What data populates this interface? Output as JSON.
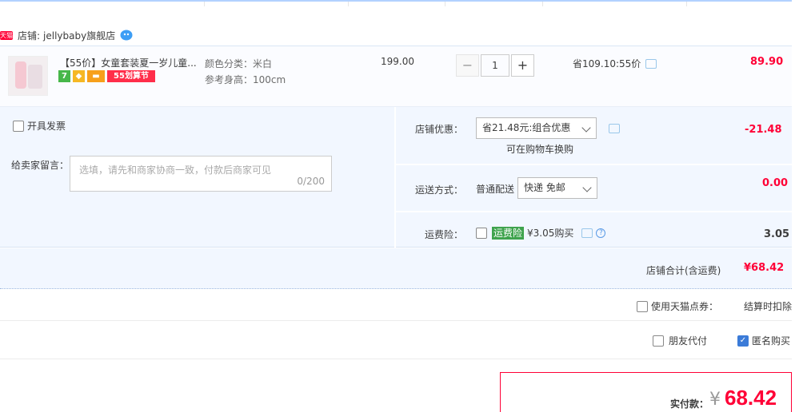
{
  "shop": {
    "badge": "天猫",
    "label": "店铺:",
    "name": "jellybaby旗舰店"
  },
  "item": {
    "title": "【55价】女童套装夏一岁儿童...",
    "badges": {
      "seven": "7",
      "promo": "55划算节"
    },
    "sku_color": "颜色分类：米白",
    "sku_height": "参考身高：100cm",
    "original_price": "199.00",
    "quantity": "1",
    "qty_minus": "−",
    "qty_plus": "+",
    "saved": "省109.10:55价",
    "price": "89.90"
  },
  "invoice": {
    "label": "开具发票"
  },
  "memo": {
    "label": "给卖家留言：",
    "placeholder": "选填，请先和商家协商一致，付款后商家可见",
    "count": "0/200"
  },
  "shop_discount": {
    "label": "店铺优惠：",
    "selected": "省21.48元:组合优惠",
    "note": "可在购物车换购",
    "value": "-21.48"
  },
  "shipping": {
    "label": "运送方式：",
    "type": "普通配送",
    "selected": "快递 免邮",
    "value": "0.00"
  },
  "insurance": {
    "label": "运费险：",
    "tag": "运费险",
    "price": "¥3.05购买",
    "value": "3.05"
  },
  "shop_total": {
    "label": "店铺合计(含运费)",
    "value": "¥68.42"
  },
  "tmall_coupon": {
    "label": "使用天猫点券：",
    "note": "结算时扣除"
  },
  "friend_pay": {
    "label": "朋友代付"
  },
  "anonymous": {
    "label": "匿名购买",
    "checked": true
  },
  "payment": {
    "label": "实付款：",
    "currency": "¥",
    "amount": "68.42"
  },
  "colors": {
    "accent_red": "#ff0036",
    "panel_blue": "#f2f7ff",
    "link_blue": "#3b7bd8"
  }
}
